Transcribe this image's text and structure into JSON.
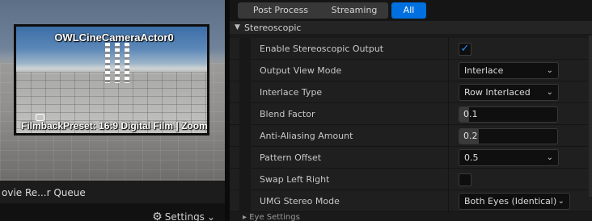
{
  "viewport": {
    "camera_name": "OWLCineCameraActor0",
    "filmback_info": "FilmbackPreset: 16:9 Digital Film | Zoom"
  },
  "left_panel": {
    "tab_label": "ovie Re...r Queue",
    "settings_label": "Settings",
    "settings_icon": "gear-icon"
  },
  "filters": [
    {
      "label": "Post Process",
      "active": false
    },
    {
      "label": "Streaming",
      "active": false
    },
    {
      "label": "All",
      "active": true
    }
  ],
  "section": {
    "title": "Stereoscopic",
    "expanded": true
  },
  "properties": [
    {
      "label": "Enable Stereoscopic Output",
      "type": "checkbox",
      "checked": true
    },
    {
      "label": "Output View Mode",
      "type": "combo",
      "value": "Interlace"
    },
    {
      "label": "Interlace Type",
      "type": "combo",
      "value": "Row Interlaced"
    },
    {
      "label": "Blend Factor",
      "type": "number",
      "value": "0.1",
      "fill_fraction": 0.1
    },
    {
      "label": "Anti-Aliasing Amount",
      "type": "number",
      "value": "0.2",
      "fill_fraction": 0.2
    },
    {
      "label": "Pattern Offset",
      "type": "combo",
      "value": "0.5"
    },
    {
      "label": "Swap Left Right",
      "type": "checkbox",
      "checked": false
    },
    {
      "label": "UMG Stereo Mode",
      "type": "combo",
      "value": "Both Eyes (Identical)"
    }
  ],
  "next_section": {
    "title": "Eye Settings"
  },
  "colors": {
    "accent": "#0070e0",
    "checkmark": "#2e8bff"
  }
}
